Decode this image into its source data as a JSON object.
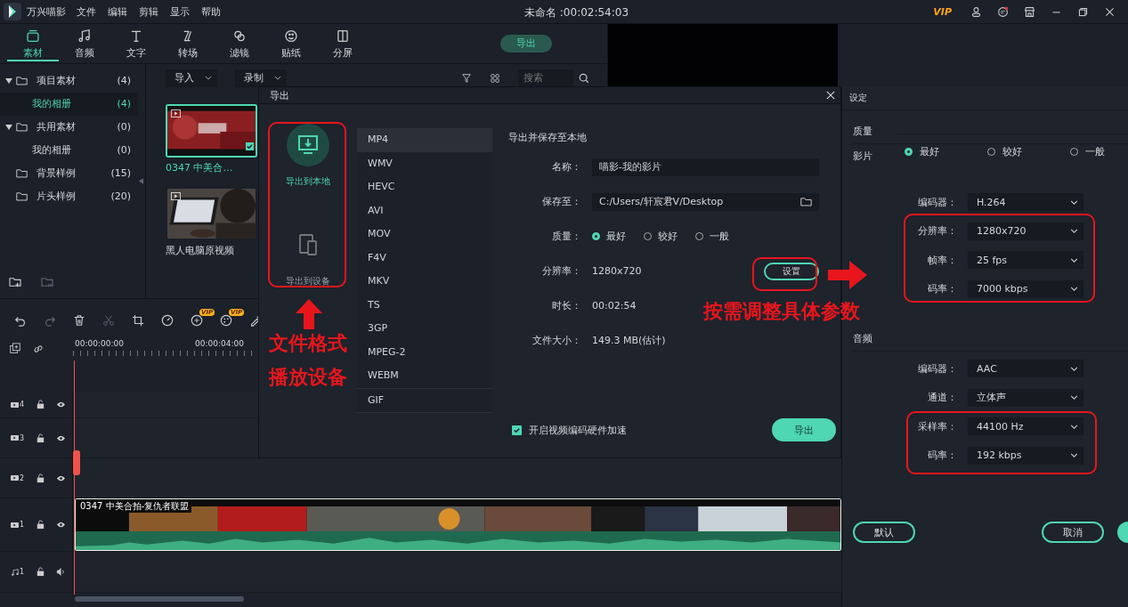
{
  "app": {
    "name": "万兴喵影",
    "menus": [
      "文件",
      "编辑",
      "剪辑",
      "显示",
      "帮助"
    ],
    "title": "未命名 :00:02:54:03",
    "vip": "VIP"
  },
  "toolbar": {
    "tabs": [
      {
        "label": "素材",
        "selected": true
      },
      {
        "label": "音频",
        "selected": false
      },
      {
        "label": "文字",
        "selected": false
      },
      {
        "label": "转场",
        "selected": false
      },
      {
        "label": "滤镜",
        "selected": false
      },
      {
        "label": "贴纸",
        "selected": false
      },
      {
        "label": "分屏",
        "selected": false
      }
    ],
    "export_button": "导出"
  },
  "library": {
    "tree": [
      {
        "label": "项目素材",
        "count": "(4)",
        "selected": false,
        "expanded": true,
        "children": [
          {
            "label": "我的相册",
            "count": "(4)",
            "selected": true
          }
        ]
      },
      {
        "label": "共用素材",
        "count": "(0)",
        "selected": false,
        "expanded": true,
        "children": [
          {
            "label": "我的相册",
            "count": "(0)",
            "selected": false
          }
        ]
      },
      {
        "label": "背景样例",
        "count": "(15)",
        "selected": false
      },
      {
        "label": "片头样例",
        "count": "(20)",
        "selected": false
      }
    ]
  },
  "media": {
    "import": "导入",
    "record": "录制",
    "search": {
      "placeholder": "搜索"
    },
    "clips": [
      {
        "title": "0347 中美合…",
        "selected": true
      },
      {
        "title": "黑人电脑原视频",
        "selected": false
      }
    ]
  },
  "timeline": {
    "ruler": [
      "00:00:00:00",
      "00:00:04:00"
    ],
    "tracks": [
      {
        "kind": "video",
        "number": "4"
      },
      {
        "kind": "video",
        "number": "3"
      },
      {
        "kind": "video",
        "number": "2"
      },
      {
        "kind": "video",
        "number": "1",
        "clip": "0347 中美合拍-复仇者联盟"
      },
      {
        "kind": "audio",
        "number": "1"
      }
    ],
    "vip": [
      "VIP",
      "VIP"
    ]
  },
  "export_dialog": {
    "title": "导出",
    "targets": [
      {
        "label": "导出到本地",
        "selected": true
      },
      {
        "label": "导出到设备",
        "selected": false
      }
    ],
    "formats": [
      {
        "label": "MP4",
        "selected": true
      },
      {
        "label": "WMV",
        "selected": false
      },
      {
        "label": "HEVC",
        "selected": false
      },
      {
        "label": "AVI",
        "selected": false
      },
      {
        "label": "MOV",
        "selected": false
      },
      {
        "label": "F4V",
        "selected": false
      },
      {
        "label": "MKV",
        "selected": false
      },
      {
        "label": "TS",
        "selected": false
      },
      {
        "label": "3GP",
        "selected": false
      },
      {
        "label": "MPEG-2",
        "selected": false
      },
      {
        "label": "WEBM",
        "selected": false
      },
      {
        "label": "GIF",
        "selected": false
      }
    ],
    "heading": "导出并保存至本地",
    "name": {
      "label": "名称：",
      "value": "喵影-我的影片"
    },
    "save_to": {
      "label": "保存至：",
      "value": "C:/Users/轩宸君V/Desktop"
    },
    "quality": {
      "label": "质量：",
      "options": [
        {
          "label": "最好",
          "selected": true
        },
        {
          "label": "较好",
          "selected": false
        },
        {
          "label": "一般",
          "selected": false
        }
      ]
    },
    "info": [
      {
        "label": "分辨率：",
        "value": "1280x720"
      },
      {
        "label": "时长：",
        "value": "00:02:54"
      },
      {
        "label": "文件大小：",
        "value": "149.3 MB(估计)"
      }
    ],
    "settings_button": "设置",
    "hardware_acceleration": {
      "label": "开启视频编码硬件加速",
      "checked": true
    },
    "export_button": "导出"
  },
  "settings_panel": {
    "title": "设定",
    "quality_label": "质量",
    "quality": [
      {
        "label": "最好",
        "selected": true
      },
      {
        "label": "较好",
        "selected": false
      },
      {
        "label": "一般",
        "selected": false
      }
    ],
    "video_label": "影片",
    "video": [
      {
        "label": "编码器：",
        "value": "H.264"
      },
      {
        "label": "分辨率：",
        "value": "1280x720"
      },
      {
        "label": "帧率：",
        "value": "25 fps"
      },
      {
        "label": "码率：",
        "value": "7000 kbps"
      }
    ],
    "audio_label": "音频",
    "audio": [
      {
        "label": "编码器：",
        "value": "AAC"
      },
      {
        "label": "通道：",
        "value": "立体声"
      },
      {
        "label": "采样率：",
        "value": "44100 Hz"
      },
      {
        "label": "码率：",
        "value": "192 kbps"
      }
    ],
    "default_button": "默认",
    "cancel_button": "取消"
  },
  "annotations": {
    "formats_note": [
      "文件格式",
      "播放设备"
    ],
    "settings_note": "按需调整具体参数"
  }
}
